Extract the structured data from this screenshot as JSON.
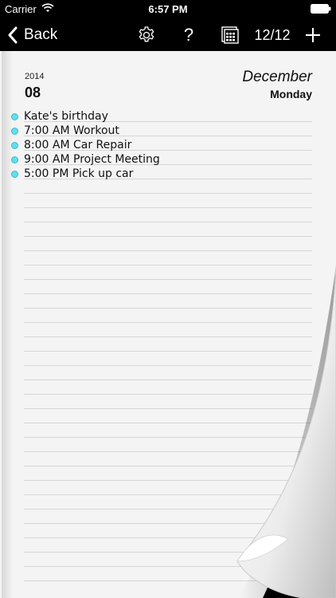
{
  "status": {
    "carrier": "Carrier",
    "time": "6:57 PM"
  },
  "nav": {
    "back_label": "Back",
    "help_label": "?",
    "counter": "12/12"
  },
  "day": {
    "year": "2014",
    "day": "08",
    "month": "December",
    "weekday": "Monday"
  },
  "events": [
    {
      "text": "Kate's birthday"
    },
    {
      "text": "7:00 AM Workout"
    },
    {
      "text": "8:00 AM Car Repair"
    },
    {
      "text": "9:00 AM Project Meeting"
    },
    {
      "text": "5:00 PM Pick up car"
    }
  ],
  "colors": {
    "event_dot": "#5fe0ee",
    "page": "#f4f4f4",
    "bar": "#000000"
  }
}
